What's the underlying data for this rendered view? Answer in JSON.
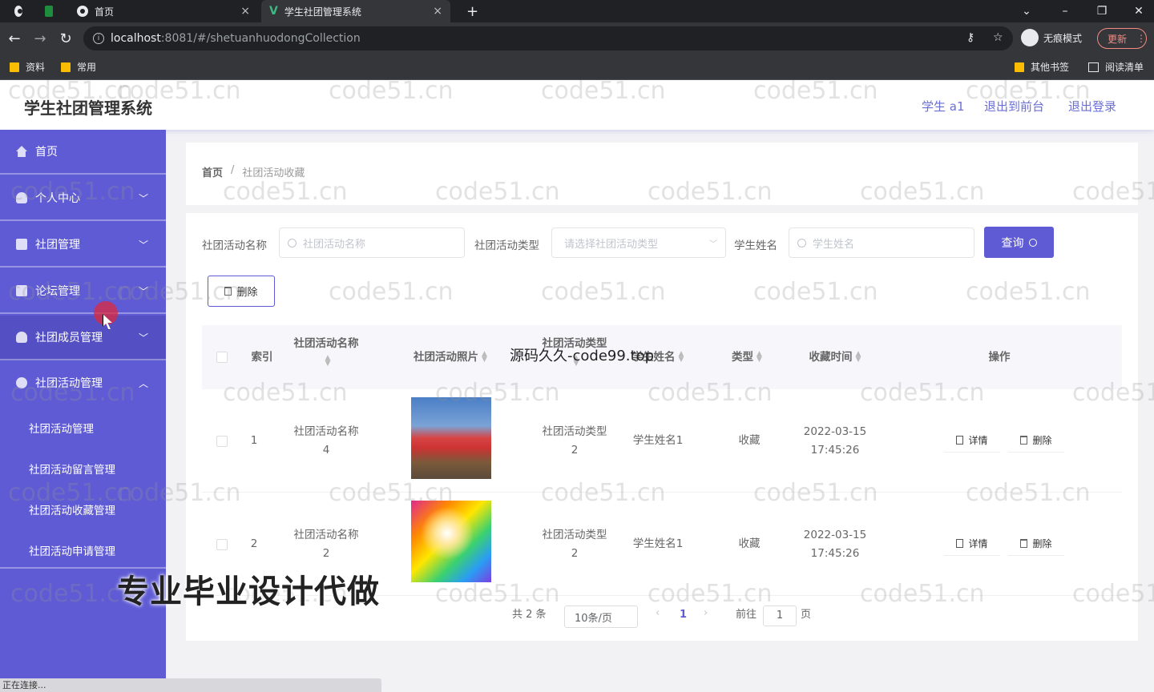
{
  "browser": {
    "tabs": [
      {
        "title": ""
      },
      {
        "title": "首页"
      },
      {
        "title": "学生社团管理系统"
      }
    ],
    "url_host": "localhost",
    "url_path": ":8081/#/shetuanhuodongCollection",
    "incognito_label": "无痕模式",
    "update_label": "更新",
    "bookmarks": [
      "资料",
      "常用"
    ],
    "bookmarks_right": [
      "其他书签",
      "阅读清单"
    ],
    "status_text": "正在连接..."
  },
  "header": {
    "title": "学生社团管理系统",
    "user": "学生 a1",
    "back_to_front": "退出到前台",
    "logout": "退出登录"
  },
  "sidebar": {
    "items": [
      {
        "label": "首页",
        "icon": "home-icon"
      },
      {
        "label": "个人中心",
        "icon": "user-icon"
      },
      {
        "label": "社团管理",
        "icon": "folder-icon"
      },
      {
        "label": "论坛管理",
        "icon": "chat-icon"
      },
      {
        "label": "社团成员管理",
        "icon": "user-icon"
      },
      {
        "label": "社团活动管理",
        "icon": "gear-icon"
      }
    ],
    "sub_items": [
      "社团活动管理",
      "社团活动留言管理",
      "社团活动收藏管理",
      "社团活动申请管理"
    ]
  },
  "breadcrumb": {
    "home": "首页",
    "separator": "/",
    "current": "社团活动收藏"
  },
  "filters": {
    "name_label": "社团活动名称",
    "name_placeholder": "社团活动名称",
    "type_label": "社团活动类型",
    "type_placeholder": "请选择社团活动类型",
    "student_label": "学生姓名",
    "student_placeholder": "学生姓名",
    "query_label": "查询",
    "delete_label": "删除"
  },
  "table": {
    "headers": {
      "index": "索引",
      "name": "社团活动名称",
      "photo": "社团活动照片",
      "type": "社团活动类型",
      "student": "学生姓名",
      "kind": "类型",
      "time": "收藏时间",
      "ops": "操作"
    },
    "rows": [
      {
        "index": "1",
        "name_1": "社团活动名称",
        "name_2": "4",
        "type_1": "社团活动类型",
        "type_2": "2",
        "student": "学生姓名1",
        "kind": "收藏",
        "date": "2022-03-15",
        "time": "17:45:26"
      },
      {
        "index": "2",
        "name_1": "社团活动名称",
        "name_2": "2",
        "type_1": "社团活动类型",
        "type_2": "2",
        "student": "学生姓名1",
        "kind": "收藏",
        "date": "2022-03-15",
        "time": "17:45:26"
      }
    ],
    "detail_label": "详情",
    "delete_label": "删除"
  },
  "pagination": {
    "total": "共 2 条",
    "page_size": "10条/页",
    "current_page": "1",
    "goto_label": "前往",
    "goto_value": "1",
    "page_unit": "页"
  },
  "overlays": {
    "watermark": "code51.cn",
    "promo": "专业毕业设计代做",
    "promo2": "源码久久-code99.top"
  },
  "colors": {
    "accent": "#5f5bd4",
    "header_link": "#6b6fd4"
  }
}
